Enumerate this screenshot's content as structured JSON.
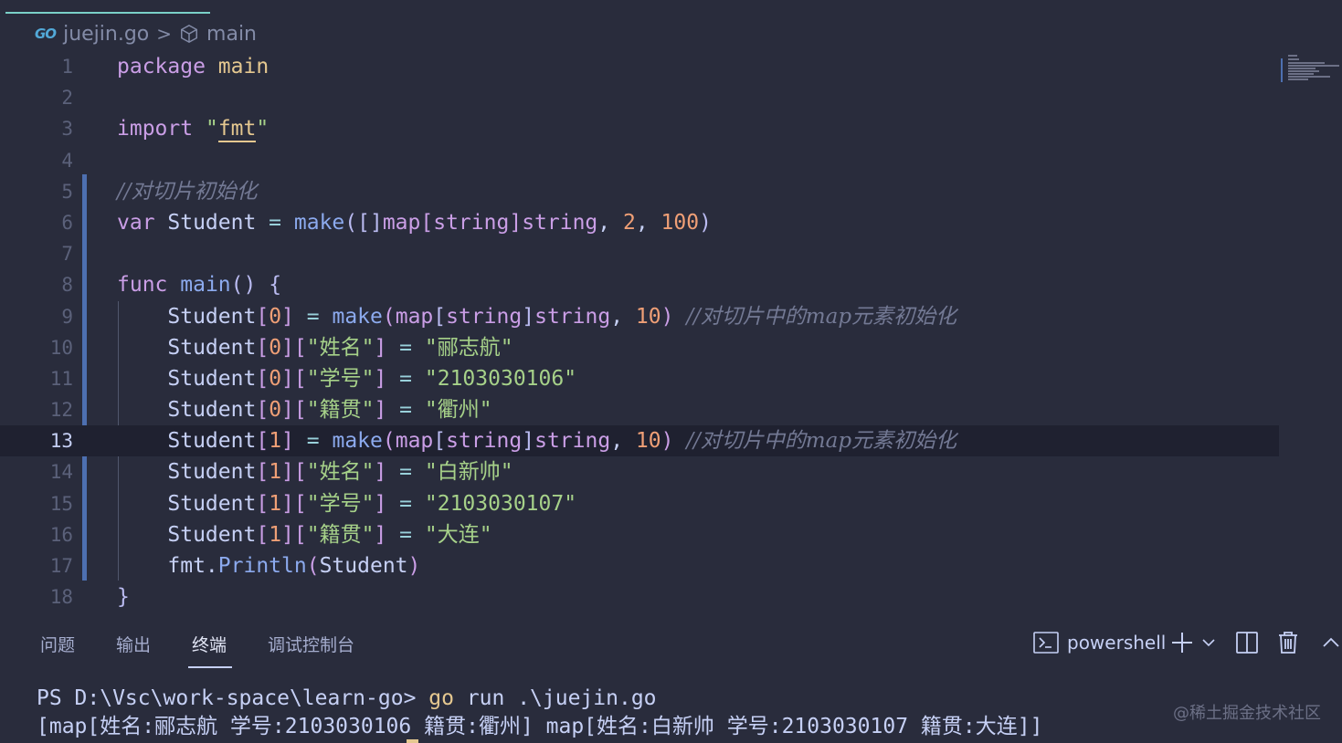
{
  "tab": {
    "file_name": "juejin.go"
  },
  "breadcrumb": {
    "file_icon_text": "GO",
    "file": "juejin.go",
    "separator": ">",
    "symbol": "main"
  },
  "editor": {
    "current_line": 13,
    "line_numbers": [
      "1",
      "2",
      "3",
      "4",
      "5",
      "6",
      "7",
      "8",
      "9",
      "10",
      "11",
      "12",
      "13",
      "14",
      "15",
      "16",
      "17",
      "18"
    ],
    "lines": [
      [
        {
          "c": "kw",
          "t": "package"
        },
        {
          "c": "pl",
          "t": " "
        },
        {
          "c": "ty",
          "t": "main"
        }
      ],
      [],
      [
        {
          "c": "kw",
          "t": "import"
        },
        {
          "c": "pl",
          "t": " "
        },
        {
          "c": "str",
          "t": "\""
        },
        {
          "c": "ty fmt-under",
          "t": "fmt"
        },
        {
          "c": "str",
          "t": "\""
        }
      ],
      [],
      [
        {
          "c": "cm",
          "t": "//对切片初始化"
        }
      ],
      [
        {
          "c": "kw",
          "t": "var"
        },
        {
          "c": "pl",
          "t": " Student "
        },
        {
          "c": "op",
          "t": "="
        },
        {
          "c": "pl",
          "t": " "
        },
        {
          "c": "fn",
          "t": "make"
        },
        {
          "c": "bracket1",
          "t": "([]"
        },
        {
          "c": "kw",
          "t": "map"
        },
        {
          "c": "bracket2",
          "t": "["
        },
        {
          "c": "kw",
          "t": "string"
        },
        {
          "c": "bracket2",
          "t": "]"
        },
        {
          "c": "kw",
          "t": "string"
        },
        {
          "c": "pl",
          "t": ", "
        },
        {
          "c": "num",
          "t": "2"
        },
        {
          "c": "pl",
          "t": ", "
        },
        {
          "c": "num",
          "t": "100"
        },
        {
          "c": "bracket1",
          "t": ")"
        }
      ],
      [],
      [
        {
          "c": "kw",
          "t": "func"
        },
        {
          "c": "pl",
          "t": " "
        },
        {
          "c": "fn",
          "t": "main"
        },
        {
          "c": "bracket1",
          "t": "()"
        },
        {
          "c": "pl",
          "t": " "
        },
        {
          "c": "bracket1",
          "t": "{"
        }
      ],
      [
        {
          "c": "pl",
          "t": "    Student"
        },
        {
          "c": "bracket2",
          "t": "["
        },
        {
          "c": "idx",
          "t": "0"
        },
        {
          "c": "bracket2",
          "t": "]"
        },
        {
          "c": "pl",
          "t": " "
        },
        {
          "c": "op",
          "t": "="
        },
        {
          "c": "pl",
          "t": " "
        },
        {
          "c": "fn",
          "t": "make"
        },
        {
          "c": "bracket2",
          "t": "("
        },
        {
          "c": "kw",
          "t": "map"
        },
        {
          "c": "bracket1",
          "t": "["
        },
        {
          "c": "kw",
          "t": "string"
        },
        {
          "c": "bracket1",
          "t": "]"
        },
        {
          "c": "kw",
          "t": "string"
        },
        {
          "c": "pl",
          "t": ", "
        },
        {
          "c": "num",
          "t": "10"
        },
        {
          "c": "bracket2",
          "t": ")"
        },
        {
          "c": "pl",
          "t": " "
        },
        {
          "c": "cm",
          "t": "//对切片中的map元素初始化"
        }
      ],
      [
        {
          "c": "pl",
          "t": "    Student"
        },
        {
          "c": "bracket2",
          "t": "["
        },
        {
          "c": "idx",
          "t": "0"
        },
        {
          "c": "bracket2",
          "t": "]["
        },
        {
          "c": "str",
          "t": "\"姓名\""
        },
        {
          "c": "bracket2",
          "t": "]"
        },
        {
          "c": "pl",
          "t": " "
        },
        {
          "c": "op",
          "t": "="
        },
        {
          "c": "pl",
          "t": " "
        },
        {
          "c": "str",
          "t": "\"郦志航\""
        }
      ],
      [
        {
          "c": "pl",
          "t": "    Student"
        },
        {
          "c": "bracket2",
          "t": "["
        },
        {
          "c": "idx",
          "t": "0"
        },
        {
          "c": "bracket2",
          "t": "]["
        },
        {
          "c": "str",
          "t": "\"学号\""
        },
        {
          "c": "bracket2",
          "t": "]"
        },
        {
          "c": "pl",
          "t": " "
        },
        {
          "c": "op",
          "t": "="
        },
        {
          "c": "pl",
          "t": " "
        },
        {
          "c": "str",
          "t": "\"2103030106\""
        }
      ],
      [
        {
          "c": "pl",
          "t": "    Student"
        },
        {
          "c": "bracket2",
          "t": "["
        },
        {
          "c": "idx",
          "t": "0"
        },
        {
          "c": "bracket2",
          "t": "]["
        },
        {
          "c": "str",
          "t": "\"籍贯\""
        },
        {
          "c": "bracket2",
          "t": "]"
        },
        {
          "c": "pl",
          "t": " "
        },
        {
          "c": "op",
          "t": "="
        },
        {
          "c": "pl",
          "t": " "
        },
        {
          "c": "str",
          "t": "\"衢州\""
        }
      ],
      [
        {
          "c": "pl",
          "t": "    Student"
        },
        {
          "c": "bracket2",
          "t": "["
        },
        {
          "c": "idx",
          "t": "1"
        },
        {
          "c": "bracket2",
          "t": "]"
        },
        {
          "c": "pl",
          "t": " "
        },
        {
          "c": "op",
          "t": "="
        },
        {
          "c": "pl",
          "t": " "
        },
        {
          "c": "fn",
          "t": "make"
        },
        {
          "c": "bracket2",
          "t": "("
        },
        {
          "c": "kw",
          "t": "map"
        },
        {
          "c": "bracket1",
          "t": "["
        },
        {
          "c": "kw",
          "t": "string"
        },
        {
          "c": "bracket1",
          "t": "]"
        },
        {
          "c": "kw",
          "t": "string"
        },
        {
          "c": "pl",
          "t": ", "
        },
        {
          "c": "num",
          "t": "10"
        },
        {
          "c": "bracket2",
          "t": ")"
        },
        {
          "c": "pl",
          "t": " "
        },
        {
          "c": "cm",
          "t": "//对切片中的map元素初始化"
        }
      ],
      [
        {
          "c": "pl",
          "t": "    Student"
        },
        {
          "c": "bracket2",
          "t": "["
        },
        {
          "c": "idx",
          "t": "1"
        },
        {
          "c": "bracket2",
          "t": "]["
        },
        {
          "c": "str",
          "t": "\"姓名\""
        },
        {
          "c": "bracket2",
          "t": "]"
        },
        {
          "c": "pl",
          "t": " "
        },
        {
          "c": "op",
          "t": "="
        },
        {
          "c": "pl",
          "t": " "
        },
        {
          "c": "str",
          "t": "\"白新帅\""
        }
      ],
      [
        {
          "c": "pl",
          "t": "    Student"
        },
        {
          "c": "bracket2",
          "t": "["
        },
        {
          "c": "idx",
          "t": "1"
        },
        {
          "c": "bracket2",
          "t": "]["
        },
        {
          "c": "str",
          "t": "\"学号\""
        },
        {
          "c": "bracket2",
          "t": "]"
        },
        {
          "c": "pl",
          "t": " "
        },
        {
          "c": "op",
          "t": "="
        },
        {
          "c": "pl",
          "t": " "
        },
        {
          "c": "str",
          "t": "\"2103030107\""
        }
      ],
      [
        {
          "c": "pl",
          "t": "    Student"
        },
        {
          "c": "bracket2",
          "t": "["
        },
        {
          "c": "idx",
          "t": "1"
        },
        {
          "c": "bracket2",
          "t": "]["
        },
        {
          "c": "str",
          "t": "\"籍贯\""
        },
        {
          "c": "bracket2",
          "t": "]"
        },
        {
          "c": "pl",
          "t": " "
        },
        {
          "c": "op",
          "t": "="
        },
        {
          "c": "pl",
          "t": " "
        },
        {
          "c": "str",
          "t": "\"大连\""
        }
      ],
      [
        {
          "c": "pl",
          "t": "    fmt."
        },
        {
          "c": "fn",
          "t": "Println"
        },
        {
          "c": "bracket2",
          "t": "("
        },
        {
          "c": "pl",
          "t": "Student"
        },
        {
          "c": "bracket2",
          "t": ")"
        }
      ],
      [
        {
          "c": "bracket1",
          "t": "}"
        }
      ]
    ]
  },
  "panel": {
    "tabs": [
      "问题",
      "输出",
      "终端",
      "调试控制台"
    ],
    "active_tab": "终端",
    "shell_label": "powershell",
    "icons": [
      "terminal-icon",
      "plus-icon",
      "chevron-down-icon",
      "split-icon",
      "trash-icon",
      "chevron-up-icon"
    ]
  },
  "terminal": {
    "prompt": "PS D:\\Vsc\\work-space\\learn-go> ",
    "command_go": "go",
    "command_rest": " run .\\juejin.go",
    "output": "[map[姓名:郦志航 学号:2103030106 籍贯:衢州] map[姓名:白新帅 学号:2103030107 籍贯:大连]]"
  },
  "watermark": "@稀土掘金技术社区",
  "colors": {
    "background": "#292c3c",
    "keyword": "#ca9ee6",
    "function": "#8caaee",
    "string": "#a6d189",
    "number": "#ef9f76",
    "comment": "#737994",
    "accent": "#e5c890"
  }
}
